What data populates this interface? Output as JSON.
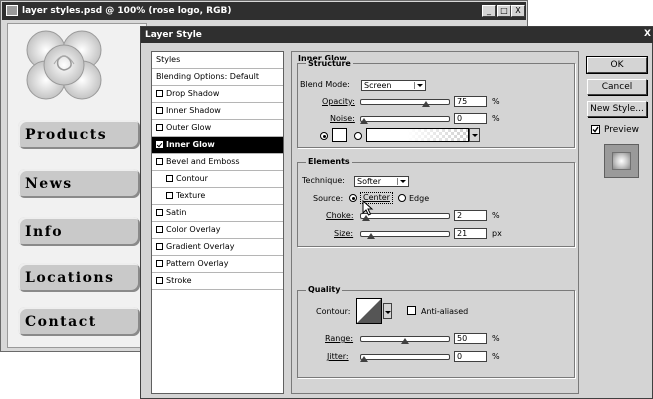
{
  "doc_window": {
    "title": "layer styles.psd @ 100% (rose logo, RGB)",
    "controls": [
      "_",
      "□",
      "X"
    ],
    "nav_buttons": [
      "Products",
      "News",
      "Info",
      "Locations",
      "Contact"
    ]
  },
  "dialog": {
    "title": "Layer Style",
    "close": "X",
    "styles_list": [
      {
        "label": "Styles",
        "type": "header"
      },
      {
        "label": "Blending Options: Default",
        "type": "header"
      },
      {
        "label": "Drop Shadow",
        "checked": false,
        "indent": 0
      },
      {
        "label": "Inner Shadow",
        "checked": false,
        "indent": 0
      },
      {
        "label": "Outer Glow",
        "checked": false,
        "indent": 0
      },
      {
        "label": "Inner Glow",
        "checked": true,
        "indent": 0,
        "selected": true
      },
      {
        "label": "Bevel and Emboss",
        "checked": false,
        "indent": 0
      },
      {
        "label": "Contour",
        "checked": false,
        "indent": 1
      },
      {
        "label": "Texture",
        "checked": false,
        "indent": 1
      },
      {
        "label": "Satin",
        "checked": false,
        "indent": 0
      },
      {
        "label": "Color Overlay",
        "checked": false,
        "indent": 0
      },
      {
        "label": "Gradient Overlay",
        "checked": false,
        "indent": 0
      },
      {
        "label": "Pattern Overlay",
        "checked": false,
        "indent": 0
      },
      {
        "label": "Stroke",
        "checked": false,
        "indent": 0
      }
    ],
    "panel_title": "Inner Glow",
    "structure": {
      "legend": "Structure",
      "blend_mode_label": "Blend Mode:",
      "blend_mode_value": "Screen",
      "opacity_label": "Opacity:",
      "opacity_value": "75",
      "opacity_unit": "%",
      "opacity_level": 75,
      "noise_label": "Noise:",
      "noise_value": "0",
      "noise_unit": "%",
      "noise_level": 0
    },
    "elements": {
      "legend": "Elements",
      "technique_label": "Technique:",
      "technique_value": "Softer",
      "source_label": "Source:",
      "source_center": "Center",
      "source_edge": "Edge",
      "choke_label": "Choke:",
      "choke_value": "2",
      "choke_unit": "%",
      "choke_level": 2,
      "size_label": "Size:",
      "size_value": "21",
      "size_unit": "px",
      "size_level": 8
    },
    "quality": {
      "legend": "Quality",
      "contour_label": "Contour:",
      "anti_aliased_label": "Anti-aliased",
      "range_label": "Range:",
      "range_value": "50",
      "range_unit": "%",
      "range_level": 50,
      "jitter_label": "Jitter:",
      "jitter_value": "0",
      "jitter_unit": "%",
      "jitter_level": 0
    },
    "buttons": {
      "ok": "OK",
      "cancel": "Cancel",
      "new_style": "New Style...",
      "preview": "Preview",
      "preview_checked": true
    }
  }
}
